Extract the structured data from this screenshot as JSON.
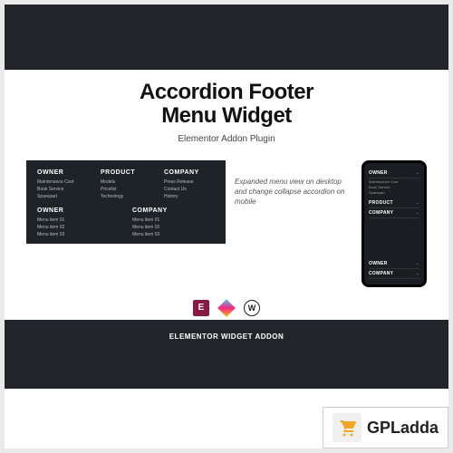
{
  "hero": {
    "title_line1": "Accordion Footer",
    "title_line2": "Menu Widget",
    "subtitle": "Elementor Addon Plugin"
  },
  "desktop": {
    "row1": {
      "col1": {
        "heading": "OWNER",
        "items": [
          "Maintenance Cost",
          "Book Service",
          "Sparepart"
        ]
      },
      "col2": {
        "heading": "PRODUCT",
        "items": [
          "Models",
          "Pricelist",
          "Technology"
        ]
      },
      "col3": {
        "heading": "COMPANY",
        "items": [
          "Press Release",
          "Contact Us",
          "History"
        ]
      }
    },
    "row2": {
      "col1": {
        "heading": "OWNER",
        "items": [
          "Menu item 01",
          "Menu item 02",
          "Menu item 03"
        ]
      },
      "col2": {
        "heading": "COMPANY",
        "items": [
          "Menu item 01",
          "Menu item 02",
          "Menu item 03"
        ]
      }
    }
  },
  "caption": "Expanded menu view on desktop and change collapse accordion on mobile",
  "mobile": {
    "section1": {
      "row1": {
        "heading": "OWNER",
        "items": [
          "Maintenance Cost",
          "Book Service",
          "Sparepart"
        ]
      },
      "row2": {
        "heading": "PRODUCT"
      },
      "row3": {
        "heading": "COMPANY"
      }
    },
    "section2": {
      "row1": {
        "heading": "OWNER"
      },
      "row2": {
        "heading": "COMPANY"
      }
    }
  },
  "footer_label": "ELEMENTOR WIDGET ADDON",
  "brand": {
    "name": "GPLadda"
  }
}
